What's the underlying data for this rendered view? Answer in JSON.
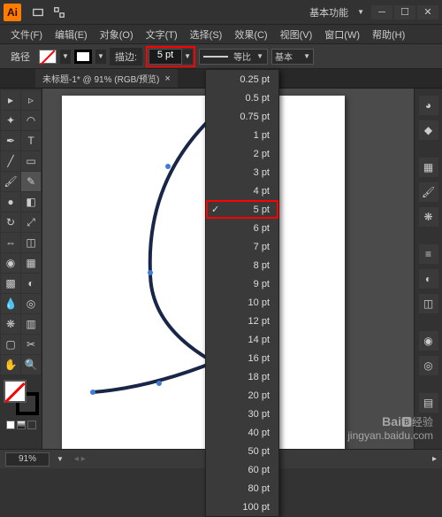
{
  "app": {
    "logo": "Ai"
  },
  "titlebar": {
    "workspace": "基本功能"
  },
  "menu": {
    "file": "文件(F)",
    "edit": "编辑(E)",
    "object": "对象(O)",
    "type": "文字(T)",
    "select": "选择(S)",
    "effect": "效果(C)",
    "view": "视图(V)",
    "window": "窗口(W)",
    "help": "帮助(H)"
  },
  "controlbar": {
    "pathLabel": "路径",
    "strokeBtn": "描边:",
    "strokeValue": "5 pt",
    "profileLabel": "等比",
    "brushLabel": "基本"
  },
  "document": {
    "tabTitle": "未标题-1* @ 91% (RGB/预览)",
    "close": "×"
  },
  "strokeOptions": [
    "0.25 pt",
    "0.5 pt",
    "0.75 pt",
    "1 pt",
    "2 pt",
    "3 pt",
    "4 pt",
    "5 pt",
    "6 pt",
    "7 pt",
    "8 pt",
    "9 pt",
    "10 pt",
    "12 pt",
    "14 pt",
    "16 pt",
    "18 pt",
    "20 pt",
    "30 pt",
    "40 pt",
    "50 pt",
    "60 pt",
    "80 pt",
    "100 pt"
  ],
  "selectedStroke": "5 pt",
  "statusbar": {
    "zoom": "91%",
    "tool": "铅笔"
  },
  "watermark": {
    "line1": "Bai",
    "line2": "经验",
    "sub": "jingyan.baidu.com"
  }
}
